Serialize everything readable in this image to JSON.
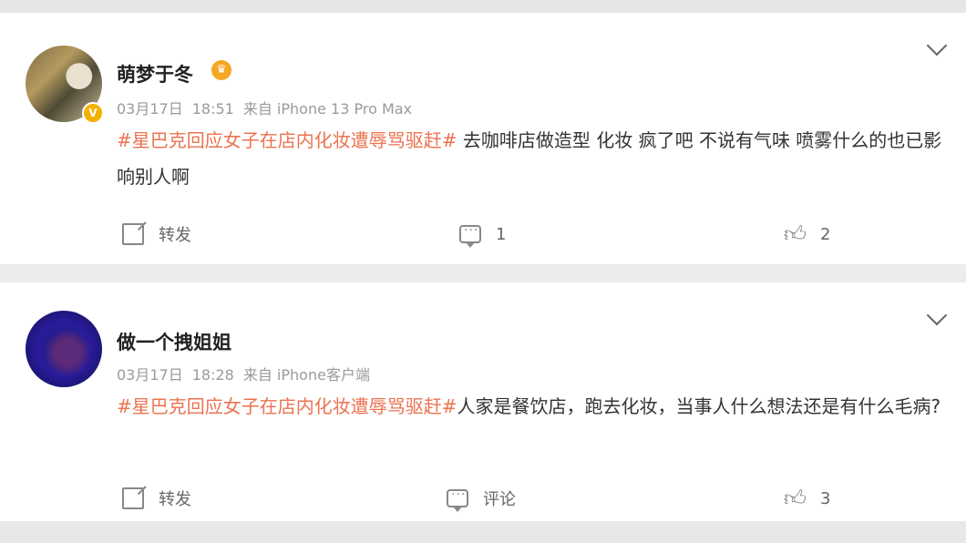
{
  "posts": [
    {
      "username": "萌梦于冬",
      "verified_badge": "V",
      "crown_badge": "♛",
      "date": "03月17日",
      "time": "18:51",
      "source": "来自 iPhone 13 Pro Max",
      "topic": "#星巴克回应女子在店内化妆遭辱骂驱赶#",
      "text": " 去咖啡店做造型 化妆 疯了吧 不说有气味 喷雾什么的也已影响别人啊",
      "actions": {
        "repost_label": "转发",
        "comment_label": "1",
        "like_count": "2"
      }
    },
    {
      "username": "做一个拽姐姐",
      "date": "03月17日",
      "time": "18:28",
      "source": "来自 iPhone客户端",
      "topic": "#星巴克回应女子在店内化妆遭辱骂驱赶#",
      "text": "人家是餐饮店，跑去化妆，当事人什么想法还是有什么毛病?",
      "actions": {
        "repost_label": "转发",
        "comment_label": "评论",
        "like_count": "3"
      }
    }
  ],
  "icons": {
    "more": "chevron-down-icon",
    "repost": "share-icon",
    "comment": "comment-icon",
    "like": "thumbs-up-icon"
  },
  "colors": {
    "topic": "#eb7350",
    "verified": "#f5b100",
    "background": "#ececec"
  }
}
